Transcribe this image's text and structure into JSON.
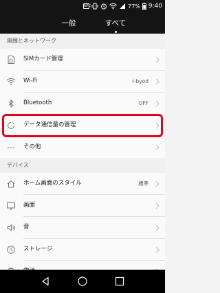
{
  "status": {
    "time": "9:40",
    "battery": "77%",
    "nfc": "NFC"
  },
  "tabs": [
    {
      "label": "一般"
    },
    {
      "label": "すべて"
    }
  ],
  "sections": [
    {
      "title": "無線とネットワーク"
    },
    {
      "title": "デバイス"
    }
  ],
  "rows": [
    {
      "label": "SIMカード管理",
      "value": "",
      "icon": "sim-card-icon"
    },
    {
      "label": "Wi-Fi",
      "value": "r-byod",
      "icon": "wifi-icon"
    },
    {
      "label": "Bluetooth",
      "value": "OFF",
      "icon": "bluetooth-icon"
    },
    {
      "label": "データ通信量の管理",
      "value": "",
      "icon": "data-usage-icon"
    },
    {
      "label": "その他",
      "value": "",
      "icon": "more-icon"
    },
    {
      "label": "ホーム画面のスタイル",
      "value": "標準",
      "icon": "home-icon"
    },
    {
      "label": "画面",
      "value": "",
      "icon": "display-icon"
    },
    {
      "label": "音",
      "value": "",
      "icon": "sound-icon"
    },
    {
      "label": "ストレージ",
      "value": "",
      "icon": "storage-icon"
    },
    {
      "label": "電池",
      "value": "",
      "icon": "battery-icon"
    }
  ],
  "colors": {
    "highlight": "#e8001c",
    "statusbar": "#141414"
  }
}
